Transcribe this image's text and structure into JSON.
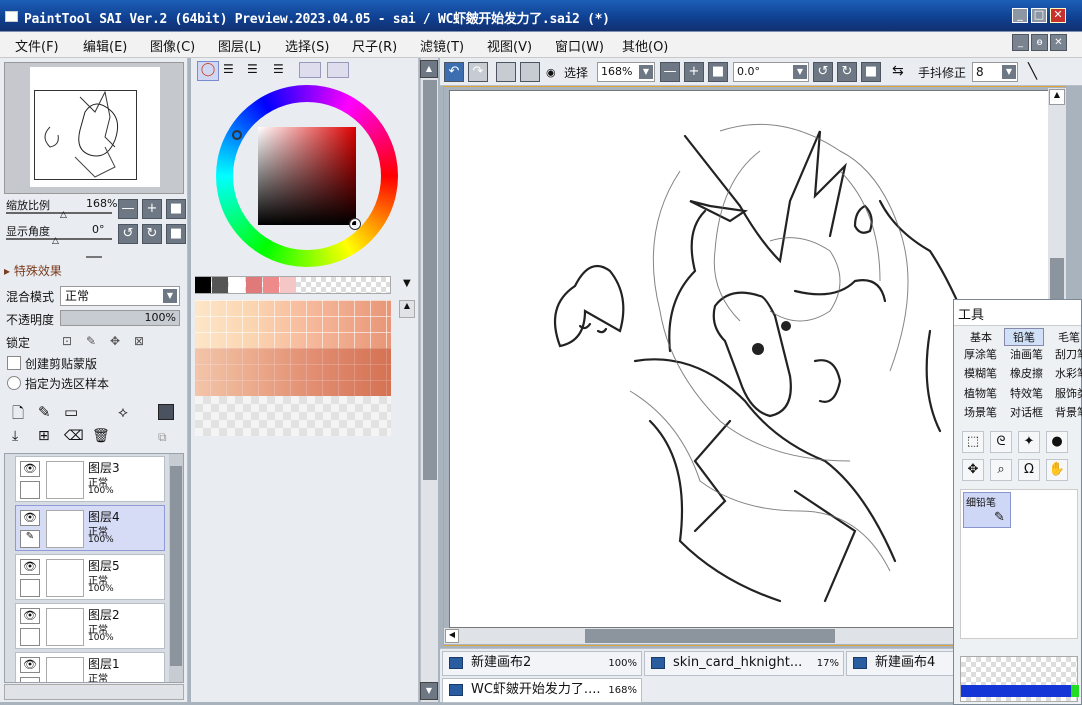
{
  "window": {
    "title": "PaintTool SAI Ver.2 (64bit) Preview.2023.04.05 - sai / WC虾皴开始发力了.sai2 (*)",
    "min": "_",
    "max": "□",
    "close": "✕"
  },
  "menu": [
    "文件(F)",
    "编辑(E)",
    "图像(C)",
    "图层(L)",
    "选择(S)",
    "尺子(R)",
    "滤镜(T)",
    "视图(V)",
    "窗口(W)",
    "其他(O)"
  ],
  "mdi_buttons": [
    "_",
    "ɵ",
    "✕"
  ],
  "navigator": {
    "zoom_label": "缩放比例",
    "zoom_value": "168%",
    "angle_label": "显示角度",
    "angle_value": "0°",
    "minus": "—",
    "plus": "+",
    "reset": "■",
    "rot_left": "↺",
    "rot_right": "↻"
  },
  "layer_props": {
    "effects": "▸ 特殊效果",
    "blend_label": "混合模式",
    "blend_value": "正常",
    "opacity_label": "不透明度",
    "opacity_value": "100%",
    "lock_label": "锁定",
    "clip_label": "创建剪贴蒙版",
    "sample_label": "指定为选区样本"
  },
  "layers": [
    {
      "name": "图层3",
      "mode": "正常",
      "opacity": "100%",
      "selected": false
    },
    {
      "name": "图层4",
      "mode": "正常",
      "opacity": "100%",
      "selected": true
    },
    {
      "name": "图层5",
      "mode": "正常",
      "opacity": "100%",
      "selected": false
    },
    {
      "name": "图层2",
      "mode": "正常",
      "opacity": "100%",
      "selected": false
    },
    {
      "name": "图层1",
      "mode": "正常",
      "opacity": "",
      "selected": false
    }
  ],
  "canvas_toolbar": {
    "select_label": "选择",
    "zoom": "168%",
    "angle": "0.0°",
    "stabilizer_label": "手抖修正",
    "stabilizer_value": "8"
  },
  "tabs": [
    {
      "name": "新建画布2",
      "zoom": "100%"
    },
    {
      "name": "skin_card_hknight...",
      "zoom": "17%"
    },
    {
      "name": "新建画布4",
      "zoom": ""
    },
    {
      "name": "WC虾皴开始发力了....",
      "zoom": "168%"
    }
  ],
  "tools": {
    "title": "工具",
    "tabs": [
      "基本",
      "铅笔",
      "毛笔"
    ],
    "rows": [
      [
        "厚涂笔",
        "油画笔",
        "刮刀笔"
      ],
      [
        "模糊笔",
        "橡皮擦",
        "水彩笔"
      ],
      [
        "植物笔",
        "特效笔",
        "服饰类"
      ],
      [
        "场景笔",
        "对话框",
        "背景笔"
      ]
    ],
    "active_brush": "细铅笔"
  },
  "colors": {
    "swatches": [
      "#000000",
      "#555555",
      "#ffffff",
      "#e07a7a",
      "#ee8a8a",
      "#f5c6c6"
    ]
  }
}
